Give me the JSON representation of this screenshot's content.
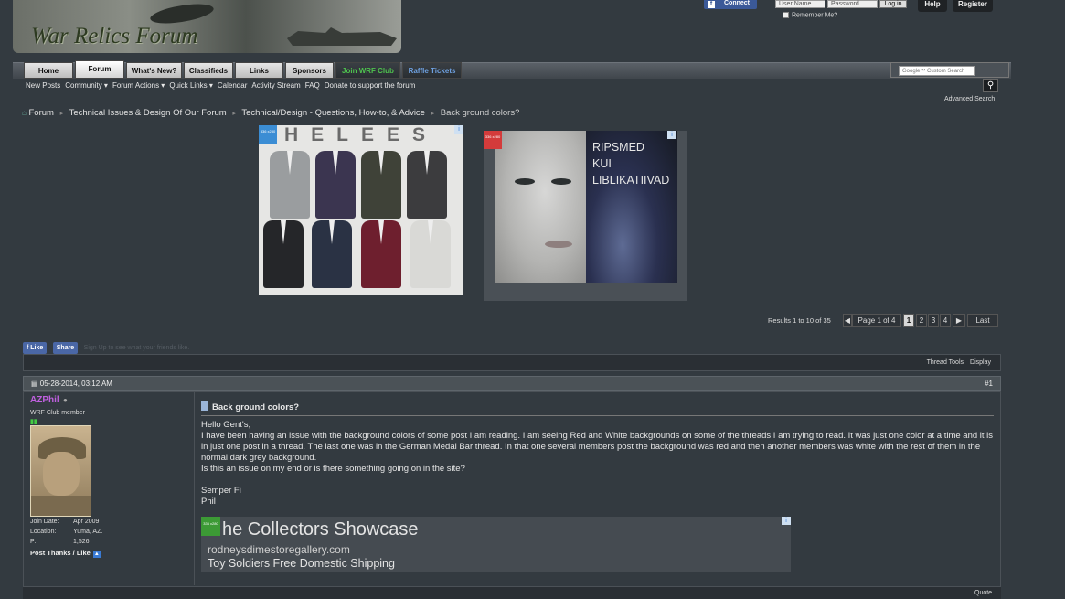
{
  "header": {
    "site_name": "War Relics Forum",
    "fb_connect": "Connect",
    "username_placeholder": "User Name",
    "password_placeholder": "Password",
    "login_label": "Log in",
    "remember_label": "Remember Me?",
    "help_label": "Help",
    "register_label": "Register"
  },
  "nav": {
    "tabs": [
      {
        "label": "Home",
        "color": "#111111"
      },
      {
        "label": "Forum",
        "color": "#111111"
      },
      {
        "label": "What's New?",
        "color": "#111111"
      },
      {
        "label": "Classifieds",
        "color": "#111111"
      },
      {
        "label": "Links",
        "color": "#111111"
      },
      {
        "label": "Sponsors",
        "color": "#111111"
      },
      {
        "label": "Join WRF Club",
        "color": "#4ec14e"
      },
      {
        "label": "Raffle Tickets",
        "color": "#6ea0e0"
      }
    ],
    "google_search_placeholder": "Google™ Custom Search"
  },
  "subnav": {
    "items": [
      "New Posts",
      "Community ▾",
      "Forum Actions ▾",
      "Quick Links ▾",
      "Calendar",
      "Activity Stream",
      "FAQ",
      "Donate to support the forum"
    ],
    "advanced_search": "Advanced Search"
  },
  "breadcrumb": {
    "items": [
      "Forum",
      "Technical Issues & Design Of Our Forum",
      "Technical/Design - Questions, How-to, & Advice"
    ],
    "current": "Back ground colors?"
  },
  "ads": {
    "ad1_brand": "HELEES",
    "ad_badge": "336 x280",
    "ad2_text": [
      "RIPSMED",
      "KUI",
      "LIBLIKATIIVAD"
    ],
    "ad3": {
      "headline": "he Collectors Showcase",
      "url": "rodneysdimestoregallery.com",
      "desc": "Toy Soldiers Free Domestic Shipping"
    }
  },
  "pagination": {
    "results": "Results 1 to 10 of 35",
    "page_of": "Page 1 of 4",
    "pages": [
      "1",
      "2",
      "3",
      "4"
    ],
    "last": "Last"
  },
  "social": {
    "like": "Like",
    "share": "Share",
    "signup": "Sign Up to see what your friends like."
  },
  "thread_tools": {
    "tools": "Thread Tools",
    "display": "Display"
  },
  "post": {
    "date": "05-28-2014, 03:12 AM",
    "number": "#1",
    "username": "AZPhil",
    "user_title": "WRF Club member",
    "join_date_label": "Join Date:",
    "join_date": "Apr 2009",
    "location_label": "Location:",
    "location": "Yuma, AZ.",
    "posts_label": "P:",
    "posts": "1,526",
    "post_thanks": "Post Thanks / Like",
    "title": "Back ground colors?",
    "body": [
      "Hello Gent's,",
      "I have been having an issue with the background colors of some post I am reading. I am seeing Red and White backgrounds on some of the threads I am trying to read. It was just one color at a time and it is in just one post in a thread. The last one was in the German Medal Bar thread. In that one several members post the background was red and then another members was white with the rest of them in the normal dark grey background.",
      "Is this an issue on my end or is there something going on in the site?",
      "",
      "Semper Fi",
      "Phil"
    ],
    "quote": "Quote"
  }
}
